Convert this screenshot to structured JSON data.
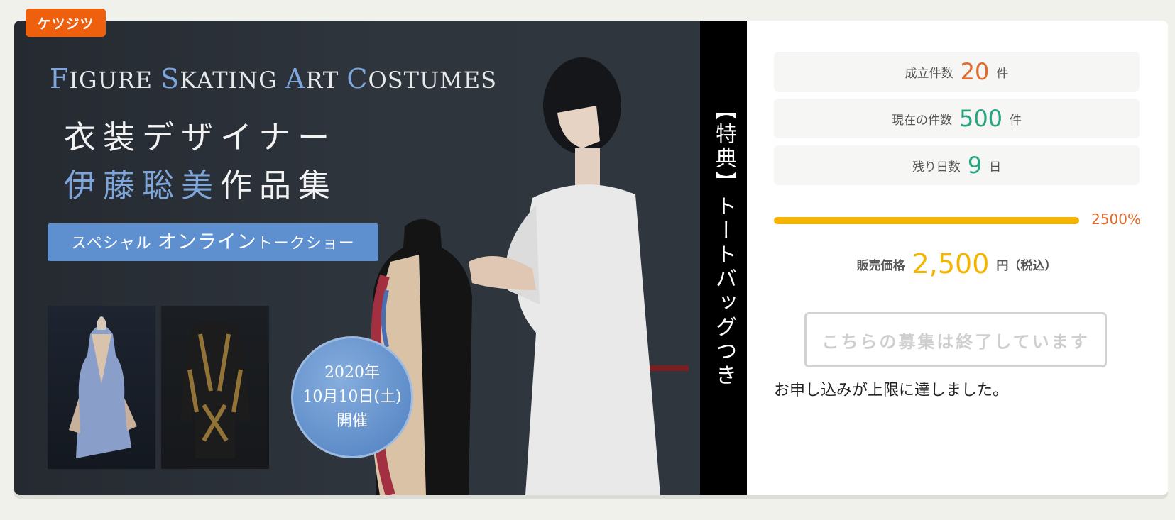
{
  "badge": {
    "label": "ケツジツ"
  },
  "banner": {
    "title_parts": [
      "F",
      "IGURE ",
      "S",
      "KATING ",
      "A",
      "RT ",
      "C",
      "OSTUMES"
    ],
    "designer_line": "衣装デザイナー",
    "name_blue": "伊藤聡美",
    "name_rest": "作品集",
    "talk_show_prefix": "スペシャル",
    "talk_show_main": "オンライン",
    "talk_show_suffix": "トークショー",
    "date_year": "2020年",
    "date_day": "10月10日(土)",
    "date_event": "開催",
    "side_text": "【特典】トートバッグつき"
  },
  "stats": {
    "established": {
      "label": "成立件数",
      "value": "20",
      "unit": "件",
      "color": "#e26a2c"
    },
    "current": {
      "label": "現在の件数",
      "value": "500",
      "unit": "件",
      "color": "#29a483"
    },
    "remaining": {
      "label": "残り日数",
      "value": "9",
      "unit": "日",
      "color": "#29a483"
    }
  },
  "progress": {
    "percent_text": "2500%",
    "fill_fraction": 1.0,
    "color": "#f5b400"
  },
  "price": {
    "label": "販売価格",
    "value": "2,500",
    "unit": "円（税込）"
  },
  "action": {
    "closed_label": "こちらの募集は終了しています",
    "limit_note": "お申し込みが上限に達しました。"
  },
  "colors": {
    "badge": "#ee5f0e",
    "accent_orange": "#e26a2c",
    "accent_green": "#29a483",
    "accent_gold": "#f5b400",
    "background": "#f1f1ec"
  }
}
